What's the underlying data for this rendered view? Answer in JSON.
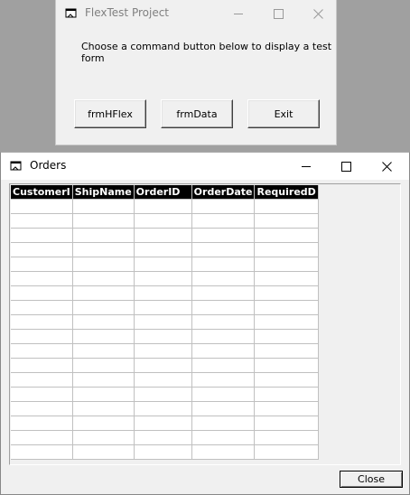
{
  "project_window": {
    "title": "FlexTest Project",
    "prompt": "Choose a command button below to display a test form",
    "buttons": {
      "hflex": "frmHFlex",
      "data": "frmData",
      "exit": "Exit"
    }
  },
  "orders_window": {
    "title": "Orders",
    "columns": [
      "CustomerI",
      "ShipName",
      "OrderID",
      "OrderDate",
      "RequiredD"
    ],
    "row_count": 18,
    "close_label": "Close"
  }
}
